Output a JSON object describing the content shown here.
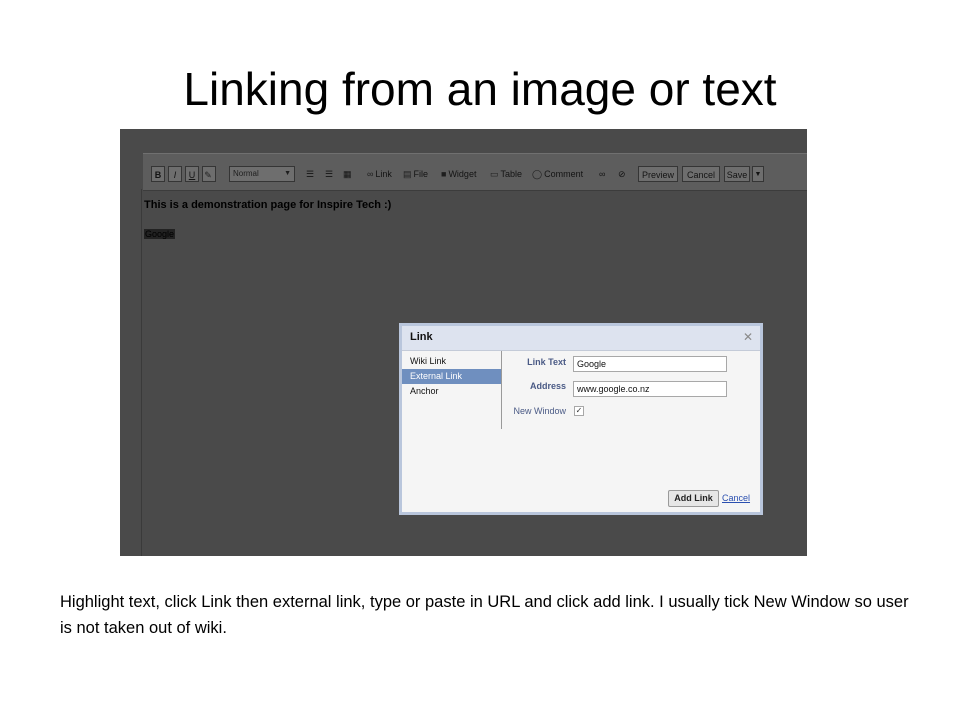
{
  "slide": {
    "title": "Linking from an image or text",
    "caption": "Highlight text, click Link then external link, type or paste in URL and click add link. I usually tick New Window so user is not taken out of wiki."
  },
  "editor": {
    "toolbar": {
      "bold": "B",
      "italic": "I",
      "underline": "U",
      "style_select": "Normal",
      "link": "Link",
      "file": "File",
      "widget": "Widget",
      "table": "Table",
      "comment": "Comment",
      "preview": "Preview",
      "cancel": "Cancel",
      "save": "Save"
    },
    "heading_text": "This is a demonstration page for Inspire Tech :)",
    "selected_text": "Google"
  },
  "link_dialog": {
    "title": "Link",
    "close_glyph": "✕",
    "tabs": [
      "Wiki Link",
      "External Link",
      "Anchor"
    ],
    "selected_tab": "External Link",
    "link_text_label": "Link Text",
    "link_text_value": "Google",
    "address_label": "Address",
    "address_value": "www.google.co.nz",
    "new_window_label": "New Window",
    "new_window_checked": true,
    "add_button": "Add Link",
    "cancel_link": "Cancel"
  }
}
